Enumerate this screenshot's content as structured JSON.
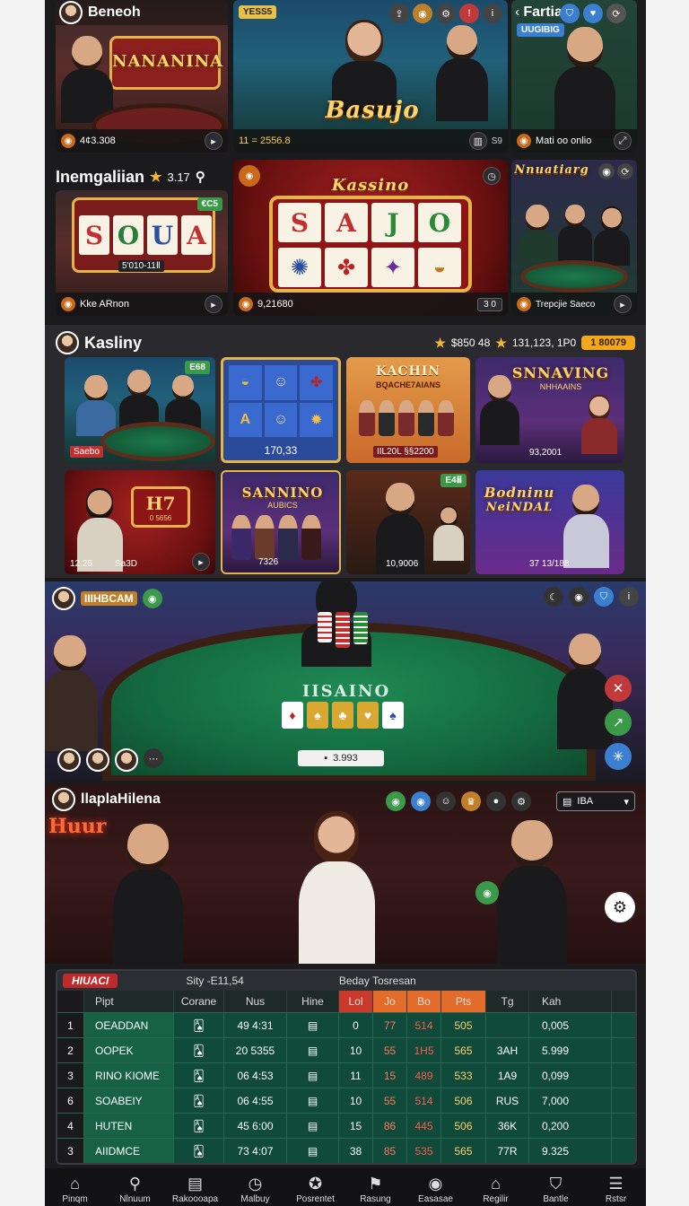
{
  "top_row": {
    "card1": {
      "user": "Beneoh",
      "title": "NANANINA",
      "amount": "4¢3.308"
    },
    "card2": {
      "badge": "YESS5",
      "title": "Basujo",
      "amount": "11 = 2556.8"
    },
    "card3": {
      "back_label": "Fartiali",
      "badge": "UUGIBIG",
      "amount": "Mati oo onlio"
    }
  },
  "second_row": {
    "header_title": "Inemgaliian",
    "header_rating": "3.17",
    "card1": {
      "reels": [
        "S",
        "O",
        "U",
        "A"
      ],
      "badge": "€C5",
      "amount": "5'010-11Ⅱ",
      "footer": "Kke ARnon"
    },
    "card2": {
      "title": "Kassino",
      "reels": [
        "S",
        "A",
        "J",
        "O"
      ],
      "amount": "9,21680",
      "btn": "3 0"
    },
    "card3": {
      "title": "Nnuatiarg",
      "footer": "Trepcjie Saeco"
    }
  },
  "kasliny": {
    "title": "Kasliny",
    "score1": "$850 48",
    "score2": "131,123, 1P0",
    "pill": "1 80079",
    "tiles": [
      {
        "label": "Saebo",
        "badge": "E68"
      },
      {
        "label": "170,33"
      },
      {
        "title": "KACHIN",
        "subtitle": "BQACHE7AIANS",
        "label": "IIL20L §§2200"
      },
      {
        "title": "SNNAVING",
        "subtitle": "NHHAAINS",
        "label": "93,2001"
      },
      {
        "badge_text": "H7",
        "small": "0 5656",
        "label": "12.25",
        "label2": "Sa3D"
      },
      {
        "title": "SANNINO",
        "subtitle": "AUBICS",
        "label": "7326"
      },
      {
        "badge": "E4ⅲ",
        "label": "10,9006"
      },
      {
        "title": "Bodninu",
        "subtitle": "NeiNDAL",
        "label": "37 13/188"
      }
    ]
  },
  "poker_table": {
    "username": "IIIHBCAM",
    "felt_text": "IISAINO",
    "bet": "3.993"
  },
  "live_room": {
    "username": "llaplaHilena",
    "dropdown": "IBA",
    "sign": "Huur"
  },
  "scoreboard": {
    "title": "HIUACI",
    "info1": "Sity -E11,54",
    "info2": "Beday Tosresan",
    "columns": [
      "Pipt",
      "Corane",
      "Nus",
      "Hine",
      "Lol",
      "Jo",
      "Bo",
      "Pts",
      "Tg",
      "Kah"
    ],
    "rows": [
      {
        "idx": "1",
        "name": "OEADDAN",
        "num": "49 4:31",
        "a": "0",
        "b": "77",
        "c": "514",
        "d": "505",
        "e": "",
        "f": "0,005"
      },
      {
        "idx": "2",
        "name": "OOPEK",
        "num": "20 5355",
        "a": "10",
        "b": "55",
        "c": "1H5",
        "d": "565",
        "e": "3AH",
        "f": "5.999"
      },
      {
        "idx": "3",
        "name": "RINO KIOME",
        "num": "06 4:53",
        "a": "11",
        "b": "15",
        "c": "489",
        "d": "533",
        "e": "1A9",
        "f": "0,099"
      },
      {
        "idx": "6",
        "name": "SOABEIY",
        "num": "06 4:55",
        "a": "10",
        "b": "55",
        "c": "514",
        "d": "506",
        "e": "RUS",
        "f": "7,000"
      },
      {
        "idx": "4",
        "name": "HUTEN",
        "num": "45 6:00",
        "a": "15",
        "b": "86",
        "c": "445",
        "d": "506",
        "e": "36K",
        "f": "0,200"
      },
      {
        "idx": "3",
        "name": "AIIDMCE",
        "num": "73 4:07",
        "a": "38",
        "b": "85",
        "c": "535",
        "d": "565",
        "e": "77R",
        "f": "9.325"
      }
    ]
  },
  "bottom_nav": [
    {
      "label": "Pinqm",
      "icon": "home-icon",
      "glyph": "⌂"
    },
    {
      "label": "Nlnuum",
      "icon": "search-icon",
      "glyph": "⚲"
    },
    {
      "label": "Rakoooapa",
      "icon": "document-icon",
      "glyph": "▤"
    },
    {
      "label": "Malbuy",
      "icon": "clock-icon",
      "glyph": "◷"
    },
    {
      "label": "Posrentet",
      "icon": "compass-icon",
      "glyph": "✪"
    },
    {
      "label": "Rasung",
      "icon": "flag-icon",
      "glyph": "⚑"
    },
    {
      "label": "Easasae",
      "icon": "casino-chip-icon",
      "glyph": "◉"
    },
    {
      "label": "Regilir",
      "icon": "building-icon",
      "glyph": "⌂"
    },
    {
      "label": "Bantle",
      "icon": "shirt-icon",
      "glyph": "⛉"
    },
    {
      "label": "Rstsr",
      "icon": "menu-icon",
      "glyph": "☰"
    }
  ]
}
